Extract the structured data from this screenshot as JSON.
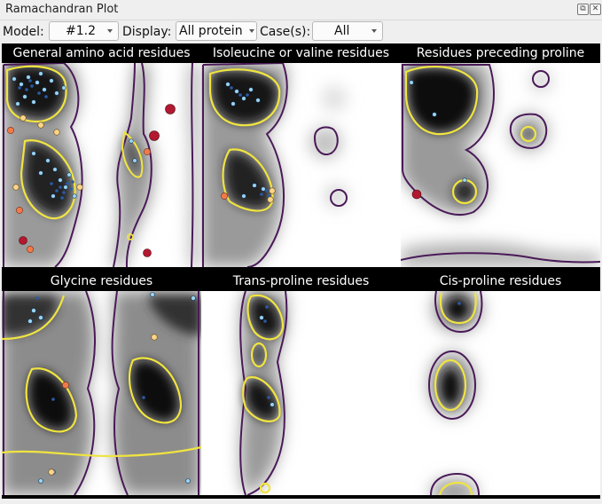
{
  "window": {
    "title": "Ramachandran Plot",
    "undock_glyph": "⧉",
    "close_glyph": "✕"
  },
  "toolbar": {
    "model_label": "Model:",
    "model_value": "#1.2",
    "display_label": "Display:",
    "display_value": "All protein",
    "cases_label": "Case(s):",
    "cases_value": "All"
  },
  "panels": [
    {
      "title": "General amino acid residues"
    },
    {
      "title": "Isoleucine or valine residues"
    },
    {
      "title": "Residues preceding proline"
    },
    {
      "title": "Glycine residues"
    },
    {
      "title": "Trans-proline residues"
    },
    {
      "title": "Cis-proline residues"
    }
  ],
  "colors": {
    "favored_contour": "#f0e440",
    "allowed_contour": "#4a1a58",
    "favored_point": "#9ad4f0",
    "dense_point": "#2a5aa8",
    "allowed_point": "#f9d48a",
    "marginal_point": "#f07a4a",
    "outlier_point": "#b41830"
  }
}
